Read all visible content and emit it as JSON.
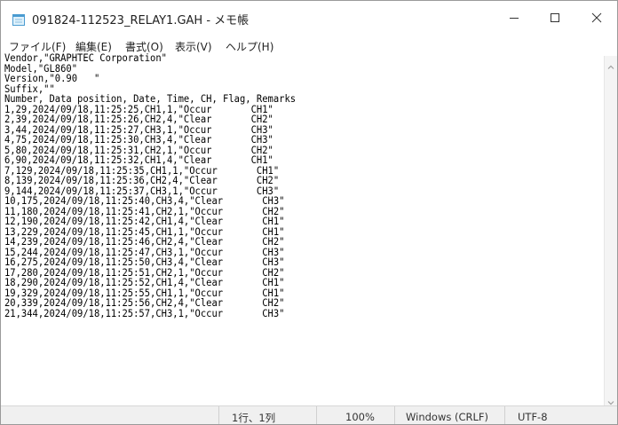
{
  "window": {
    "title": "091824-112523_RELAY1.GAH - メモ帳",
    "icon": "notepad-icon",
    "controls": {
      "minimize": "minimize-icon",
      "maximize": "maximize-icon",
      "close": "close-icon"
    }
  },
  "menubar": {
    "file": "ファイル(F)",
    "edit": "編集(E)",
    "format": "書式(O)",
    "view": "表示(V)",
    "help": "ヘルプ(H)"
  },
  "document": {
    "text": "Vendor,\"GRAPHTEC Corporation\"\nModel,\"GL860\"\nVersion,\"0.90   \"\nSuffix,\"\"\nNumber, Data position, Date, Time, CH, Flag, Remarks\n1,29,2024/09/18,11:25:25,CH1,1,\"Occur       CH1\"\n2,39,2024/09/18,11:25:26,CH2,4,\"Clear       CH2\"\n3,44,2024/09/18,11:25:27,CH3,1,\"Occur       CH3\"\n4,75,2024/09/18,11:25:30,CH3,4,\"Clear       CH3\"\n5,80,2024/09/18,11:25:31,CH2,1,\"Occur       CH2\"\n6,90,2024/09/18,11:25:32,CH1,4,\"Clear       CH1\"\n7,129,2024/09/18,11:25:35,CH1,1,\"Occur       CH1\"\n8,139,2024/09/18,11:25:36,CH2,4,\"Clear       CH2\"\n9,144,2024/09/18,11:25:37,CH3,1,\"Occur       CH3\"\n10,175,2024/09/18,11:25:40,CH3,4,\"Clear       CH3\"\n11,180,2024/09/18,11:25:41,CH2,1,\"Occur       CH2\"\n12,190,2024/09/18,11:25:42,CH1,4,\"Clear       CH1\"\n13,229,2024/09/18,11:25:45,CH1,1,\"Occur       CH1\"\n14,239,2024/09/18,11:25:46,CH2,4,\"Clear       CH2\"\n15,244,2024/09/18,11:25:47,CH3,1,\"Occur       CH3\"\n16,275,2024/09/18,11:25:50,CH3,4,\"Clear       CH3\"\n17,280,2024/09/18,11:25:51,CH2,1,\"Occur       CH2\"\n18,290,2024/09/18,11:25:52,CH1,4,\"Clear       CH1\"\n19,329,2024/09/18,11:25:55,CH1,1,\"Occur       CH1\"\n20,339,2024/09/18,11:25:56,CH2,4,\"Clear       CH2\"\n21,344,2024/09/18,11:25:57,CH3,1,\"Occur       CH3\""
  },
  "scrollbar": {
    "up": "scroll-up-icon",
    "down": "scroll-down-icon"
  },
  "statusbar": {
    "position": "1行、1列",
    "zoom": "100%",
    "line_ending": "Windows (CRLF)",
    "encoding": "UTF-8"
  }
}
